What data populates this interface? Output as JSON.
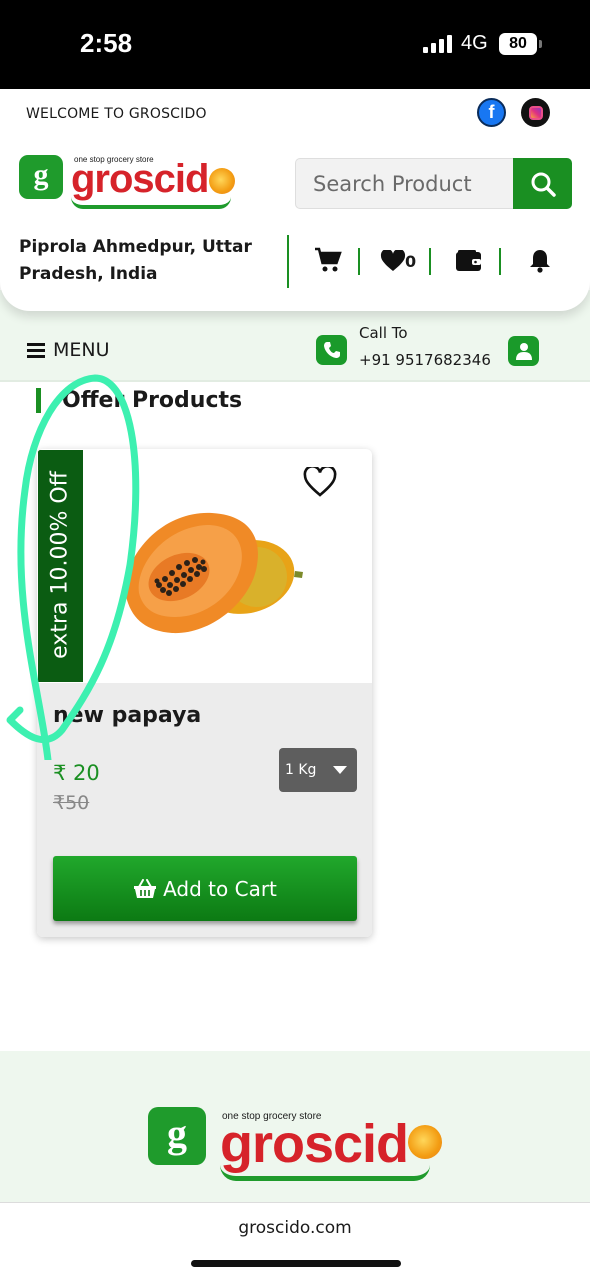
{
  "status_bar": {
    "time": "2:58",
    "network": "4G",
    "battery": "80"
  },
  "header": {
    "welcome": "WELCOME TO GROSCIDO",
    "logo": {
      "g": "g",
      "tagline": "one stop grocery store",
      "word": "groscid"
    },
    "search": {
      "placeholder": "Search Product"
    },
    "address": "Piprola Ahmedpur, Uttar Pradesh, India",
    "wishlist_count": "0"
  },
  "menu_bar": {
    "menu_label": "MENU",
    "call_label": "Call To",
    "call_number": "+91 9517682346"
  },
  "offers": {
    "title": "Offer Products",
    "products": [
      {
        "discount": "extra 10.00% Off",
        "name": "new papaya",
        "price": "₹ 20",
        "mrp": "₹50",
        "unit": "1 Kg",
        "add_to_cart": "Add to Cart"
      }
    ]
  },
  "footer": {
    "logo": {
      "g": "g",
      "tagline": "one stop grocery store",
      "word": "groscid"
    },
    "site": "groscido.com"
  },
  "colors": {
    "brand_green": "#1a8f22",
    "brand_red": "#d6232a",
    "ribbon": "#0b5c12",
    "annotation": "#3df0b0"
  }
}
